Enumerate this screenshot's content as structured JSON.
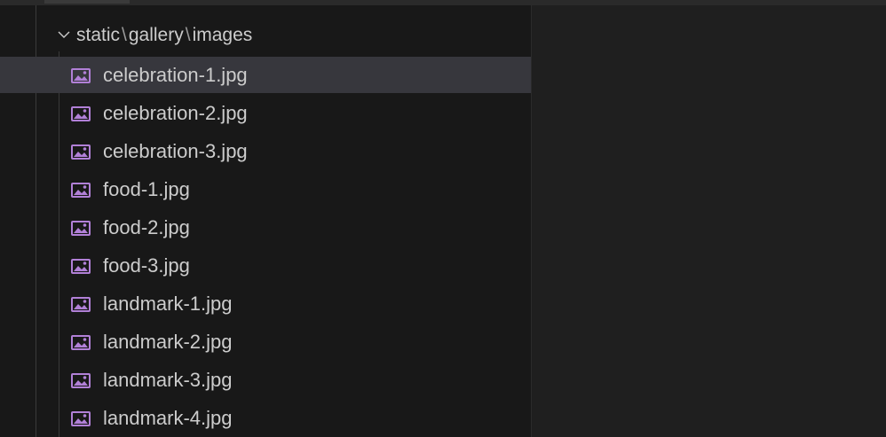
{
  "explorer": {
    "folder": {
      "segments": [
        "static",
        "gallery",
        "images"
      ],
      "separator": "\\",
      "expanded": true
    },
    "files": [
      {
        "label": "celebration-1.jpg",
        "selected": true
      },
      {
        "label": "celebration-2.jpg",
        "selected": false
      },
      {
        "label": "celebration-3.jpg",
        "selected": false
      },
      {
        "label": "food-1.jpg",
        "selected": false
      },
      {
        "label": "food-2.jpg",
        "selected": false
      },
      {
        "label": "food-3.jpg",
        "selected": false
      },
      {
        "label": "landmark-1.jpg",
        "selected": false
      },
      {
        "label": "landmark-2.jpg",
        "selected": false
      },
      {
        "label": "landmark-3.jpg",
        "selected": false
      },
      {
        "label": "landmark-4.jpg",
        "selected": false
      }
    ],
    "file_icon": "image-file-icon",
    "folder_icon": "chevron-down-icon"
  },
  "theme": {
    "explorer_bg": "#181818",
    "editor_bg": "#1f1f1f",
    "selection_bg": "#37373d",
    "text": "#cccccc",
    "icon_accent": "#b180d7"
  }
}
